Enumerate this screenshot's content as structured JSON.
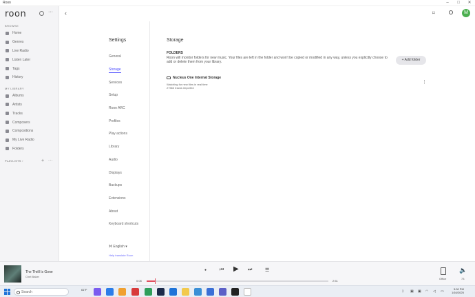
{
  "window": {
    "title": "Roon"
  },
  "sidebar": {
    "logo": "roon",
    "browse_header": "BROWSE",
    "browse_items": [
      {
        "label": "Home",
        "icon": "home-icon"
      },
      {
        "label": "Genres",
        "icon": "genres-icon"
      },
      {
        "label": "Live Radio",
        "icon": "radio-icon"
      },
      {
        "label": "Listen Later",
        "icon": "clock-icon"
      },
      {
        "label": "Tags",
        "icon": "tag-icon"
      },
      {
        "label": "History",
        "icon": "history-icon"
      }
    ],
    "library_header": "MY LIBRARY",
    "library_items": [
      {
        "label": "Albums",
        "icon": "album-icon"
      },
      {
        "label": "Artists",
        "icon": "artist-icon"
      },
      {
        "label": "Tracks",
        "icon": "music-note-icon"
      },
      {
        "label": "Composers",
        "icon": "composer-icon"
      },
      {
        "label": "Compositions",
        "icon": "composition-icon"
      },
      {
        "label": "My Live Radio",
        "icon": "radio-icon"
      },
      {
        "label": "Folders",
        "icon": "folder-icon"
      }
    ],
    "playlists_label": "PLAYLISTS ›"
  },
  "topbar": {
    "avatar_letter": "M"
  },
  "settings": {
    "title": "Settings",
    "items": [
      {
        "label": "General",
        "active": false
      },
      {
        "label": "Storage",
        "active": true
      },
      {
        "label": "Services",
        "active": false
      },
      {
        "label": "Setup",
        "active": false
      },
      {
        "label": "Roon ARC",
        "active": false
      },
      {
        "label": "Profiles",
        "active": false
      },
      {
        "label": "Play actions",
        "active": false
      },
      {
        "label": "Library",
        "active": false
      },
      {
        "label": "Audio",
        "active": false
      },
      {
        "label": "Displays",
        "active": false
      },
      {
        "label": "Backups",
        "active": false
      },
      {
        "label": "Extensions",
        "active": false
      },
      {
        "label": "About",
        "active": false
      },
      {
        "label": "Keyboard shortcuts",
        "active": false
      }
    ],
    "language": "English",
    "translate_link": "Help translate Roon"
  },
  "storage": {
    "title": "Storage",
    "folders_header": "FOLDERS",
    "description": "Roon will monitor folders for new music. Your files are left in the folder and won't be copied or modified in any way, unless you explicitly choose to add or delete them from your library.",
    "add_folder_label": "+ Add folder",
    "location_name": "Nucleus One Internal Storage",
    "location_status": "Watching for new files in real time",
    "location_tracks": "27563 tracks imported"
  },
  "now_playing": {
    "title": "The Thrill Is Gone",
    "artist": "Chet Baker",
    "elapsed": "0:08",
    "duration": "2:51",
    "progress": 0.047,
    "zone": "Office",
    "volume": "73"
  },
  "taskbar": {
    "search_placeholder": "Search",
    "weather": "61°F",
    "time": "3:00 PM",
    "date": "1/16/2025"
  },
  "colors": {
    "accent": "#4c4cff",
    "seek": "#e05060",
    "avatar": "#4caf50"
  }
}
